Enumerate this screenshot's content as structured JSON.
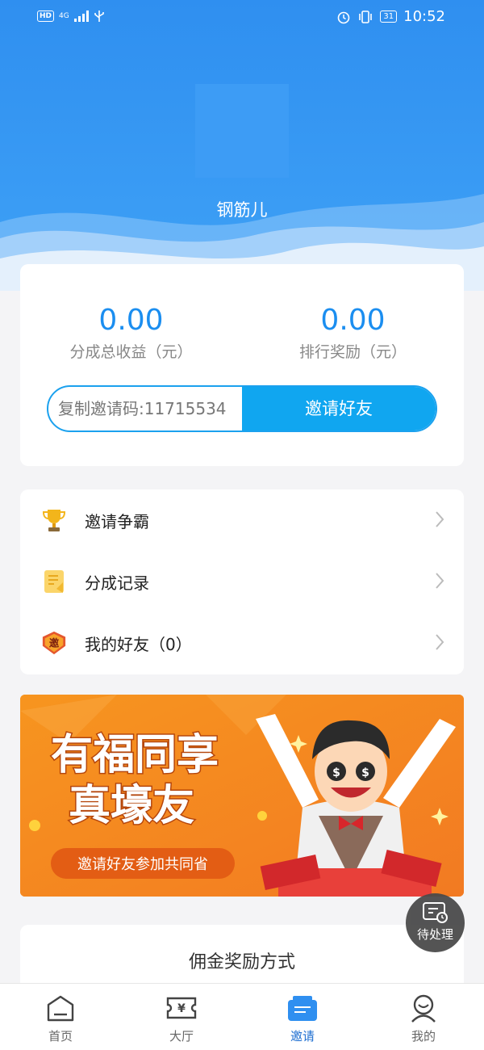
{
  "status_bar": {
    "hd": "HD",
    "network": "4G",
    "battery": "31",
    "time": "10:52"
  },
  "profile": {
    "username": "钢筋儿"
  },
  "earnings": {
    "total_share": {
      "value": "0.00",
      "label": "分成总收益（元）"
    },
    "rank_reward": {
      "value": "0.00",
      "label": "排行奖励（元）"
    },
    "invite_code_text": "复制邀请码:11715534",
    "invite_button": "邀请好友"
  },
  "menu": [
    {
      "label": "邀请争霸",
      "icon": "trophy-icon"
    },
    {
      "label": "分成记录",
      "icon": "record-icon"
    },
    {
      "label": "我的好友（0）",
      "icon": "invite-badge-icon"
    }
  ],
  "invite_badge_char": "邀",
  "banner": {
    "line1": "有福同享",
    "line2": "真壕友",
    "subtitle": "邀请好友参加共同省"
  },
  "commission": {
    "title": "佣金奖励方式"
  },
  "float_button": {
    "label": "待处理"
  },
  "tabbar": [
    {
      "label": "首页",
      "icon": "home-icon",
      "active": false
    },
    {
      "label": "大厅",
      "icon": "ticket-icon",
      "active": false
    },
    {
      "label": "邀请",
      "icon": "invite-tab-icon",
      "active": true
    },
    {
      "label": "我的",
      "icon": "profile-icon",
      "active": false
    }
  ],
  "colors": {
    "header_blue": "#2f8ff0",
    "accent_blue": "#1b8ef0",
    "button_blue": "#10a6f0",
    "banner_orange": "#f58b25",
    "tab_active": "#1f6fd1"
  }
}
